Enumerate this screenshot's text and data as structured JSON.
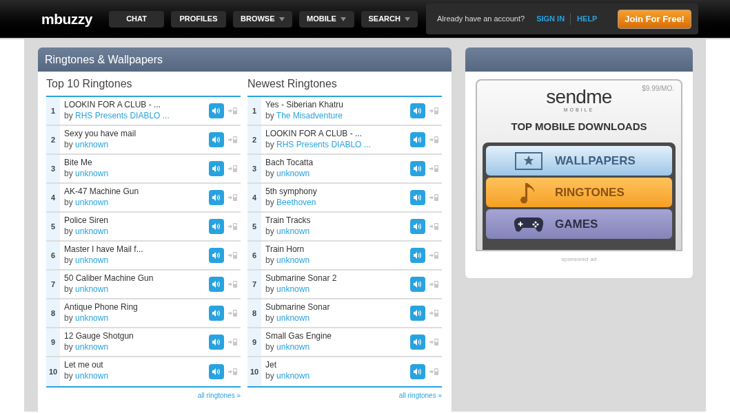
{
  "header": {
    "logo": "mbuzzy",
    "nav": [
      {
        "label": "CHAT",
        "dropdown": false
      },
      {
        "label": "PROFILES",
        "dropdown": false
      },
      {
        "label": "BROWSE",
        "dropdown": true
      },
      {
        "label": "MOBILE",
        "dropdown": true
      },
      {
        "label": "SEARCH",
        "dropdown": true
      }
    ],
    "account_prompt": "Already have an account?",
    "sign_in": "SIGN IN",
    "help": "HELP",
    "join_button": "Join For Free!"
  },
  "main_panel": {
    "title": "Ringtones & Wallpapers",
    "lists": [
      {
        "title": "Top 10 Ringtones",
        "more_link": "all ringtones »",
        "items": [
          {
            "rank": "1",
            "title": "LOOKIN FOR A CLUB - ...",
            "by": "by",
            "artist": "RHS Presents DIABLO ..."
          },
          {
            "rank": "2",
            "title": "Sexy you have mail",
            "by": "by",
            "artist": "unknown"
          },
          {
            "rank": "3",
            "title": "Bite Me",
            "by": "by",
            "artist": "unknown"
          },
          {
            "rank": "4",
            "title": "AK-47 Machine Gun",
            "by": "by",
            "artist": "unknown"
          },
          {
            "rank": "5",
            "title": "Police Siren",
            "by": "by",
            "artist": "unknown"
          },
          {
            "rank": "6",
            "title": "Master I have Mail f...",
            "by": "by",
            "artist": "unknown"
          },
          {
            "rank": "7",
            "title": "50 Caliber Machine Gun",
            "by": "by",
            "artist": "unknown"
          },
          {
            "rank": "8",
            "title": "Antique Phone Ring",
            "by": "by",
            "artist": "unknown"
          },
          {
            "rank": "9",
            "title": "12 Gauge Shotgun",
            "by": "by",
            "artist": "unknown"
          },
          {
            "rank": "10",
            "title": "Let me out",
            "by": "by",
            "artist": "unknown"
          }
        ]
      },
      {
        "title": "Newest Ringtones",
        "more_link": "all ringtones »",
        "items": [
          {
            "rank": "1",
            "title": "Yes - Siberian Khatru",
            "by": "by",
            "artist": "The Misadventure"
          },
          {
            "rank": "2",
            "title": "LOOKIN FOR A CLUB - ...",
            "by": "by",
            "artist": "RHS Presents DIABLO ..."
          },
          {
            "rank": "3",
            "title": "Bach Tocatta",
            "by": "by",
            "artist": "unknown"
          },
          {
            "rank": "4",
            "title": "5th symphony",
            "by": "by",
            "artist": "Beethoven"
          },
          {
            "rank": "5",
            "title": "Train Tracks",
            "by": "by",
            "artist": "unknown"
          },
          {
            "rank": "6",
            "title": "Train Horn",
            "by": "by",
            "artist": "unknown"
          },
          {
            "rank": "7",
            "title": "Submarine Sonar 2",
            "by": "by",
            "artist": "unknown"
          },
          {
            "rank": "8",
            "title": "Submarine Sonar",
            "by": "by",
            "artist": "unknown"
          },
          {
            "rank": "9",
            "title": "Small Gas Engine",
            "by": "by",
            "artist": "unknown"
          },
          {
            "rank": "10",
            "title": "Jet",
            "by": "by",
            "artist": "unknown"
          }
        ]
      }
    ]
  },
  "ad_panel": {
    "price": "$9.99/MO.",
    "brand": "sendme",
    "brand_sub": "MOBILE",
    "headline": "TOP MOBILE DOWNLOADS",
    "options": [
      {
        "kind": "wallpapers",
        "label": "WALLPAPERS"
      },
      {
        "kind": "ringtones",
        "label": "RINGTONES"
      },
      {
        "kind": "games",
        "label": "GAMES"
      }
    ],
    "caption": "sponsored ad"
  }
}
